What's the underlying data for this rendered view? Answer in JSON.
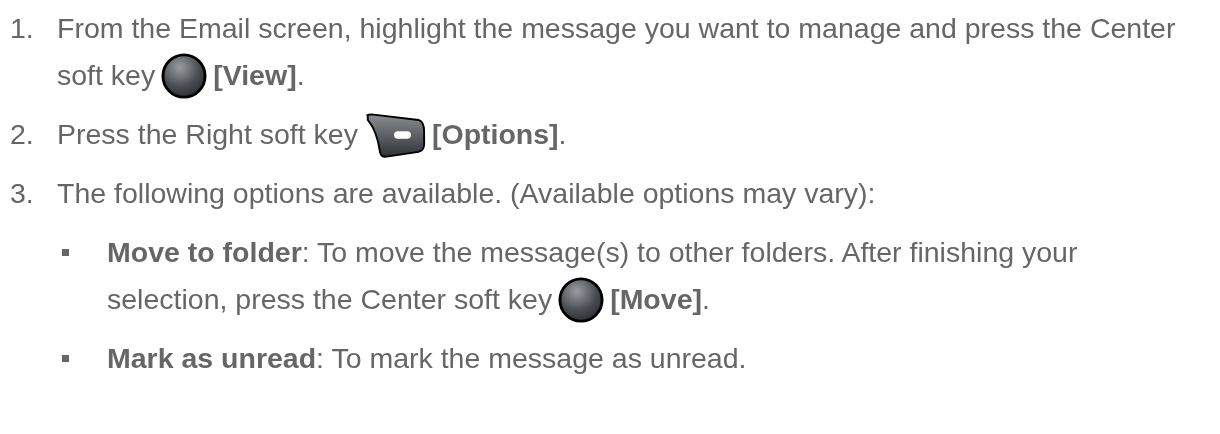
{
  "steps": [
    {
      "number": "1.",
      "lines": [
        [
          {
            "kind": "text",
            "text": "From the Email screen, highlight the message you want to manage and press the Center"
          }
        ],
        [
          {
            "kind": "text",
            "text": "soft key"
          },
          {
            "kind": "center-key"
          },
          {
            "kind": "text",
            "text": "**[View]**."
          }
        ]
      ]
    },
    {
      "number": "2.",
      "lines": [
        [
          {
            "kind": "text",
            "text": "Press the Right soft key"
          },
          {
            "kind": "right-key"
          },
          {
            "kind": "text",
            "text": "**[Options]**."
          }
        ]
      ]
    },
    {
      "number": "3.",
      "lines": [
        [
          {
            "kind": "text",
            "text": "The following options are available. (Available options may vary):"
          }
        ]
      ],
      "options": [
        {
          "lines": [
            [
              {
                "kind": "text",
                "text": "**Move to folder**: To move the message(s) to other folders. After finishing your"
              }
            ],
            [
              {
                "kind": "text",
                "text": "selection, press the Center soft key"
              },
              {
                "kind": "center-key"
              },
              {
                "kind": "text",
                "text": "**[Move]**."
              }
            ]
          ]
        },
        {
          "lines": [
            [
              {
                "kind": "text",
                "text": "**Mark as unread**: To mark the message as unread."
              }
            ]
          ]
        }
      ]
    }
  ]
}
